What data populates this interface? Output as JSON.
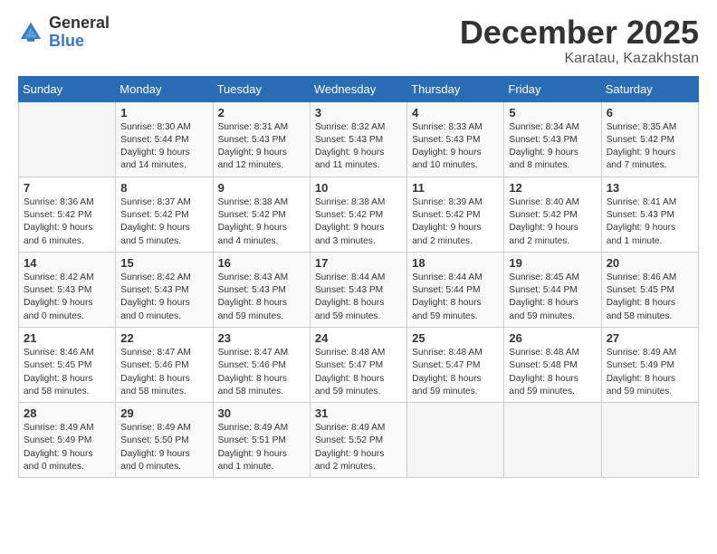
{
  "logo": {
    "general": "General",
    "blue": "Blue"
  },
  "title": "December 2025",
  "location": "Karatau, Kazakhstan",
  "days_of_week": [
    "Sunday",
    "Monday",
    "Tuesday",
    "Wednesday",
    "Thursday",
    "Friday",
    "Saturday"
  ],
  "weeks": [
    [
      {
        "day": "",
        "info": ""
      },
      {
        "day": "1",
        "info": "Sunrise: 8:30 AM\nSunset: 5:44 PM\nDaylight: 9 hours\nand 14 minutes."
      },
      {
        "day": "2",
        "info": "Sunrise: 8:31 AM\nSunset: 5:43 PM\nDaylight: 9 hours\nand 12 minutes."
      },
      {
        "day": "3",
        "info": "Sunrise: 8:32 AM\nSunset: 5:43 PM\nDaylight: 9 hours\nand 11 minutes."
      },
      {
        "day": "4",
        "info": "Sunrise: 8:33 AM\nSunset: 5:43 PM\nDaylight: 9 hours\nand 10 minutes."
      },
      {
        "day": "5",
        "info": "Sunrise: 8:34 AM\nSunset: 5:43 PM\nDaylight: 9 hours\nand 8 minutes."
      },
      {
        "day": "6",
        "info": "Sunrise: 8:35 AM\nSunset: 5:42 PM\nDaylight: 9 hours\nand 7 minutes."
      }
    ],
    [
      {
        "day": "7",
        "info": "Sunrise: 8:36 AM\nSunset: 5:42 PM\nDaylight: 9 hours\nand 6 minutes."
      },
      {
        "day": "8",
        "info": "Sunrise: 8:37 AM\nSunset: 5:42 PM\nDaylight: 9 hours\nand 5 minutes."
      },
      {
        "day": "9",
        "info": "Sunrise: 8:38 AM\nSunset: 5:42 PM\nDaylight: 9 hours\nand 4 minutes."
      },
      {
        "day": "10",
        "info": "Sunrise: 8:38 AM\nSunset: 5:42 PM\nDaylight: 9 hours\nand 3 minutes."
      },
      {
        "day": "11",
        "info": "Sunrise: 8:39 AM\nSunset: 5:42 PM\nDaylight: 9 hours\nand 2 minutes."
      },
      {
        "day": "12",
        "info": "Sunrise: 8:40 AM\nSunset: 5:42 PM\nDaylight: 9 hours\nand 2 minutes."
      },
      {
        "day": "13",
        "info": "Sunrise: 8:41 AM\nSunset: 5:43 PM\nDaylight: 9 hours\nand 1 minute."
      }
    ],
    [
      {
        "day": "14",
        "info": "Sunrise: 8:42 AM\nSunset: 5:43 PM\nDaylight: 9 hours\nand 0 minutes."
      },
      {
        "day": "15",
        "info": "Sunrise: 8:42 AM\nSunset: 5:43 PM\nDaylight: 9 hours\nand 0 minutes."
      },
      {
        "day": "16",
        "info": "Sunrise: 8:43 AM\nSunset: 5:43 PM\nDaylight: 8 hours\nand 59 minutes."
      },
      {
        "day": "17",
        "info": "Sunrise: 8:44 AM\nSunset: 5:43 PM\nDaylight: 8 hours\nand 59 minutes."
      },
      {
        "day": "18",
        "info": "Sunrise: 8:44 AM\nSunset: 5:44 PM\nDaylight: 8 hours\nand 59 minutes."
      },
      {
        "day": "19",
        "info": "Sunrise: 8:45 AM\nSunset: 5:44 PM\nDaylight: 8 hours\nand 59 minutes."
      },
      {
        "day": "20",
        "info": "Sunrise: 8:46 AM\nSunset: 5:45 PM\nDaylight: 8 hours\nand 58 minutes."
      }
    ],
    [
      {
        "day": "21",
        "info": "Sunrise: 8:46 AM\nSunset: 5:45 PM\nDaylight: 8 hours\nand 58 minutes."
      },
      {
        "day": "22",
        "info": "Sunrise: 8:47 AM\nSunset: 5:46 PM\nDaylight: 8 hours\nand 58 minutes."
      },
      {
        "day": "23",
        "info": "Sunrise: 8:47 AM\nSunset: 5:46 PM\nDaylight: 8 hours\nand 58 minutes."
      },
      {
        "day": "24",
        "info": "Sunrise: 8:48 AM\nSunset: 5:47 PM\nDaylight: 8 hours\nand 59 minutes."
      },
      {
        "day": "25",
        "info": "Sunrise: 8:48 AM\nSunset: 5:47 PM\nDaylight: 8 hours\nand 59 minutes."
      },
      {
        "day": "26",
        "info": "Sunrise: 8:48 AM\nSunset: 5:48 PM\nDaylight: 8 hours\nand 59 minutes."
      },
      {
        "day": "27",
        "info": "Sunrise: 8:49 AM\nSunset: 5:49 PM\nDaylight: 8 hours\nand 59 minutes."
      }
    ],
    [
      {
        "day": "28",
        "info": "Sunrise: 8:49 AM\nSunset: 5:49 PM\nDaylight: 9 hours\nand 0 minutes."
      },
      {
        "day": "29",
        "info": "Sunrise: 8:49 AM\nSunset: 5:50 PM\nDaylight: 9 hours\nand 0 minutes."
      },
      {
        "day": "30",
        "info": "Sunrise: 8:49 AM\nSunset: 5:51 PM\nDaylight: 9 hours\nand 1 minute."
      },
      {
        "day": "31",
        "info": "Sunrise: 8:49 AM\nSunset: 5:52 PM\nDaylight: 9 hours\nand 2 minutes."
      },
      {
        "day": "",
        "info": ""
      },
      {
        "day": "",
        "info": ""
      },
      {
        "day": "",
        "info": ""
      }
    ]
  ]
}
